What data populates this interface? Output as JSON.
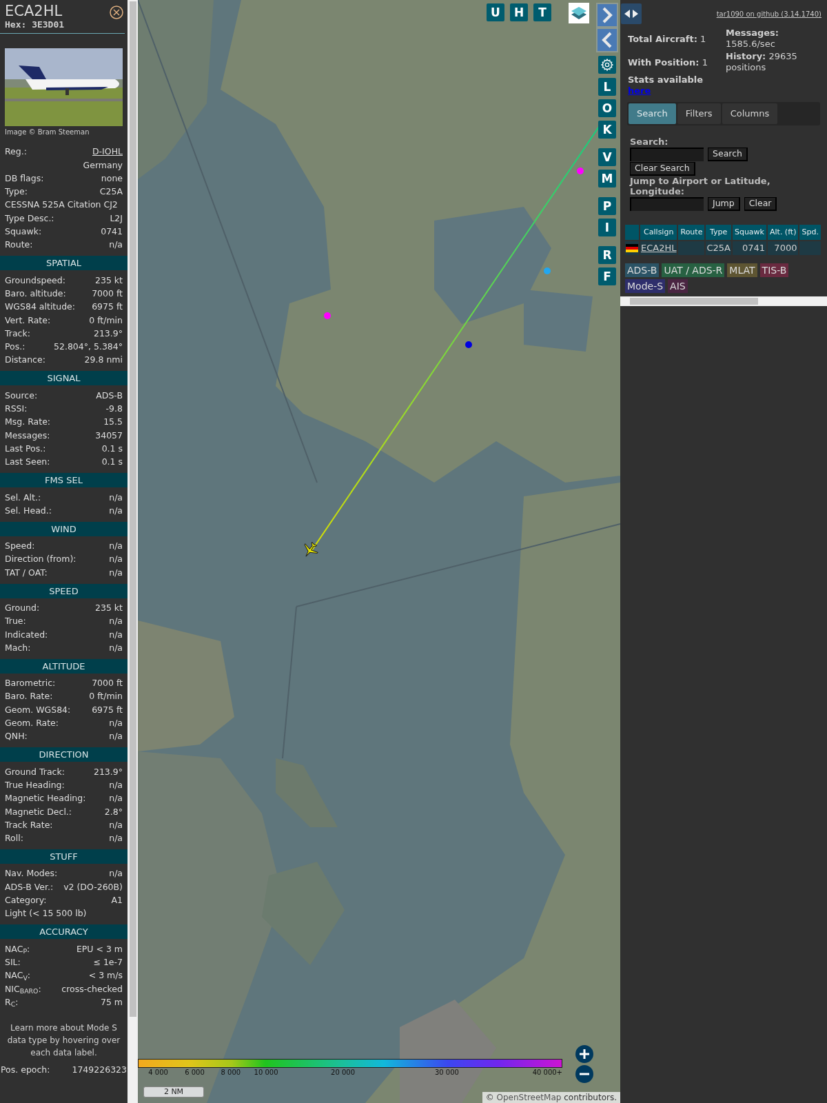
{
  "aircraft": {
    "callsign": "ECA2HL",
    "hex": "Hex: 3E3D01"
  },
  "photo": {
    "credit": "Image © Bram Steeman"
  },
  "sections": [
    {
      "rows": [
        {
          "kind": "link",
          "label": "Reg.:",
          "value": "D-IOHL"
        },
        {
          "kind": "value",
          "value": "Germany"
        },
        {
          "kind": "pair",
          "label": "DB flags:",
          "value": "none"
        },
        {
          "kind": "pair",
          "label": "Type:",
          "value": "C25A"
        },
        {
          "kind": "line",
          "value": "CESSNA 525A Citation CJ2"
        },
        {
          "kind": "pair",
          "label": "Type Desc.:",
          "value": "L2J"
        },
        {
          "kind": "pair",
          "label": "Squawk:",
          "value": "0741"
        },
        {
          "kind": "pair",
          "label": "Route:",
          "value": "n/a"
        }
      ]
    },
    {
      "title": "SPATIAL",
      "rows": [
        {
          "kind": "pair",
          "label": "Groundspeed:",
          "value": "235 kt"
        },
        {
          "kind": "pair",
          "label": "Baro. altitude:",
          "value": "7000 ft"
        },
        {
          "kind": "pair",
          "label": "WGS84 altitude:",
          "value": "6975 ft"
        },
        {
          "kind": "pair",
          "label": "Vert. Rate:",
          "value": "0 ft/min"
        },
        {
          "kind": "pair",
          "label": "Track:",
          "value": "213.9°"
        },
        {
          "kind": "pair",
          "label": "Pos.:",
          "value": "52.804°, 5.384°"
        },
        {
          "kind": "pair",
          "label": "Distance:",
          "value": "29.8 nmi"
        }
      ]
    },
    {
      "title": "SIGNAL",
      "rows": [
        {
          "kind": "pair",
          "label": "Source:",
          "value": "ADS-B"
        },
        {
          "kind": "pair",
          "label": "RSSI:",
          "value": "-9.8"
        },
        {
          "kind": "pair",
          "label": "Msg. Rate:",
          "value": "15.5"
        },
        {
          "kind": "pair",
          "label": "Messages:",
          "value": "34057"
        },
        {
          "kind": "pair",
          "label": "Last Pos.:",
          "value": "0.1 s"
        },
        {
          "kind": "pair",
          "label": "Last Seen:",
          "value": "0.1 s"
        }
      ]
    },
    {
      "title": "FMS SEL",
      "rows": [
        {
          "kind": "pair",
          "label": "Sel. Alt.:",
          "value": "n/a"
        },
        {
          "kind": "pair",
          "label": "Sel. Head.:",
          "value": "n/a"
        }
      ]
    },
    {
      "title": "WIND",
      "rows": [
        {
          "kind": "pair",
          "label": "Speed:",
          "value": "n/a"
        },
        {
          "kind": "pair",
          "label": "Direction (from):",
          "value": "n/a"
        },
        {
          "kind": "pair",
          "label": "TAT / OAT:",
          "value": "n/a"
        }
      ]
    },
    {
      "title": "SPEED",
      "rows": [
        {
          "kind": "pair",
          "label": "Ground:",
          "value": "235 kt"
        },
        {
          "kind": "pair",
          "label": "True:",
          "value": "n/a"
        },
        {
          "kind": "pair",
          "label": "Indicated:",
          "value": "n/a"
        },
        {
          "kind": "pair",
          "label": "Mach:",
          "value": "n/a"
        }
      ]
    },
    {
      "title": "ALTITUDE",
      "rows": [
        {
          "kind": "pair",
          "label": "Barometric:",
          "value": "7000 ft"
        },
        {
          "kind": "pair",
          "label": "Baro. Rate:",
          "value": "0 ft/min"
        },
        {
          "kind": "pair",
          "label": "Geom. WGS84:",
          "value": "6975 ft"
        },
        {
          "kind": "pair",
          "label": "Geom. Rate:",
          "value": "n/a"
        },
        {
          "kind": "pair",
          "label": "QNH:",
          "value": "n/a"
        }
      ]
    },
    {
      "title": "DIRECTION",
      "rows": [
        {
          "kind": "pair",
          "label": "Ground Track:",
          "value": "213.9°"
        },
        {
          "kind": "pair",
          "label": "True Heading:",
          "value": "n/a"
        },
        {
          "kind": "pair",
          "label": "Magnetic Heading:",
          "value": "n/a"
        },
        {
          "kind": "pair",
          "label": "Magnetic Decl.:",
          "value": "2.8°"
        },
        {
          "kind": "pair",
          "label": "Track Rate:",
          "value": "n/a"
        },
        {
          "kind": "pair",
          "label": "Roll:",
          "value": "n/a"
        }
      ]
    },
    {
      "title": "STUFF",
      "rows": [
        {
          "kind": "pair",
          "label": "Nav. Modes:",
          "value": "n/a"
        },
        {
          "kind": "pair",
          "label": "ADS-B Ver.:",
          "value": "v2 (DO-260B)"
        },
        {
          "kind": "pair",
          "label": "Category:",
          "value": "A1"
        },
        {
          "kind": "line",
          "value": "Light (< 15 500 lb)"
        }
      ]
    },
    {
      "title": "ACCURACY",
      "rows": [
        {
          "kind": "pair",
          "label": "NAC$_{P}$:",
          "value": "EPU < 3 m"
        },
        {
          "kind": "pair",
          "label": "SIL:",
          "value": "≤ 1e-7"
        },
        {
          "kind": "pair",
          "label": "NAC$_{V}$:",
          "value": "< 3 m/s"
        },
        {
          "kind": "pair",
          "label": "NIC$_{BARO}$:",
          "value": "cross-checked"
        },
        {
          "kind": "pair",
          "label": "R$_{C}$:",
          "value": "75 m"
        }
      ]
    }
  ],
  "note": "Learn more about Mode S data type by hovering over each data label.",
  "epoch": {
    "label": "Pos. epoch:",
    "value": "1749226323"
  },
  "map": {
    "top_buttons": [
      "U",
      "H",
      "T"
    ],
    "side_buttons": [
      [
        "L",
        "O",
        "K"
      ],
      [
        "V",
        "M"
      ],
      [
        "P",
        "I"
      ],
      [
        "R",
        "F"
      ]
    ],
    "altitude_scale": [
      "4 000",
      "6 000",
      "8 000",
      "10 000",
      "20 000",
      "30 000",
      "40 000+"
    ],
    "scale_bar": "2 NM",
    "attribution": {
      "prefix": "©",
      "link": "OpenStreetMap",
      "suffix": "contributors."
    }
  },
  "sidebar": {
    "github_link": "tar1090 on github (3.14.1740)",
    "stats": [
      "**Total Aircraft:** 1",
      "**Messages:** 1585.6/sec",
      "**With Position:** 1",
      "**History:** 29635 positions"
    ],
    "stats_note": "Stats available",
    "stats_link": "here",
    "tabs": [
      {
        "label": "Search",
        "selected": true
      },
      {
        "label": "Filters",
        "selected": false
      },
      {
        "label": "Columns",
        "selected": false
      }
    ],
    "search_label": "Search:",
    "search_button": "Search",
    "clear_search_button": "Clear Search",
    "jump_label": "Jump to Airport or Latitude, Longitude:",
    "jump_button": "Jump",
    "clear_button": "Clear",
    "table": {
      "columns": [
        "Callsign",
        "Route",
        "Type",
        "Squawk",
        "Alt. (ft)",
        "Spd."
      ],
      "rows": [
        {
          "callsign": "ECA2HL",
          "route": "",
          "type": "C25A",
          "squawk": "0741",
          "altitude": "7000"
        }
      ]
    },
    "sources": [
      {
        "label": "ADS-B",
        "color": "#2b5365"
      },
      {
        "label": "UAT / ADS-R",
        "color": "#276142"
      },
      {
        "label": "MLAT",
        "color": "#5e5532"
      },
      {
        "label": "TIS-B",
        "color": "#6a2a40"
      },
      {
        "label": "Mode-S",
        "color": "#2e2e6c"
      },
      {
        "label": "AIS",
        "color": "#4a2542"
      }
    ]
  }
}
